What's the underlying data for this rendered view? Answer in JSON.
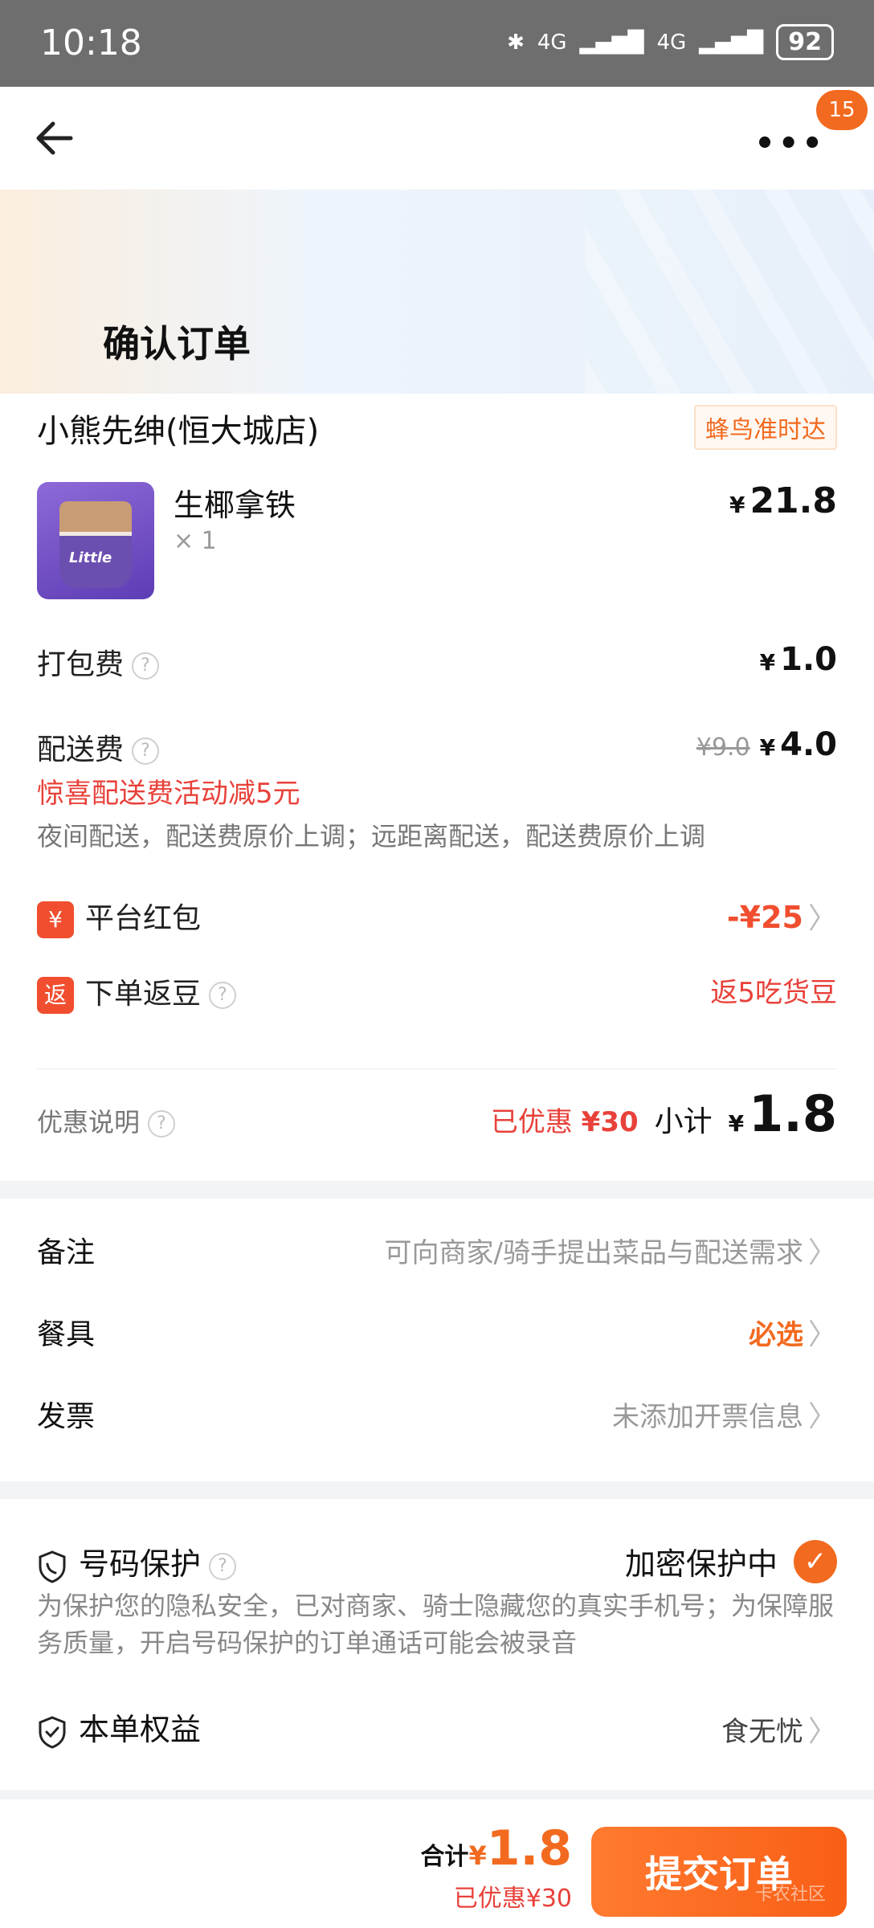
{
  "status_bar": {
    "time": "10:18",
    "battery": "92",
    "signal_labels": [
      "4G",
      "4G"
    ]
  },
  "nav": {
    "more_label": "•••",
    "badge": "15"
  },
  "page_title": "确认订单",
  "shop": {
    "name": "小熊先绅(恒大城店)",
    "delivery_tag": "蜂鸟准时达"
  },
  "item": {
    "name": "生椰拿铁",
    "qty": "× 1",
    "price": "21.8",
    "currency": "¥",
    "image_text": "Little"
  },
  "fees": {
    "packing_label": "打包费",
    "packing_price": "1.0",
    "delivery_label": "配送费",
    "delivery_original": "¥9.0",
    "delivery_price": "4.0",
    "delivery_promo": "惊喜配送费活动减5元",
    "delivery_note": "夜间配送，配送费原价上调；远距离配送，配送费原价上调"
  },
  "benefits": {
    "red_packet_icon": "¥",
    "red_packet_label": "平台红包",
    "red_packet_value": "-¥25",
    "beans_icon": "返",
    "beans_label": "下单返豆",
    "beans_value": "返5吃货豆"
  },
  "summary": {
    "discount_label": "优惠说明",
    "saved_label": "已优惠",
    "saved_value": "¥30",
    "subtotal_label": "小计",
    "subtotal_value": "1.8"
  },
  "options": [
    {
      "label": "备注",
      "value": "可向商家/骑手提出菜品与配送需求"
    },
    {
      "label": "餐具",
      "value": "必选"
    },
    {
      "label": "发票",
      "value": "未添加开票信息"
    }
  ],
  "privacy": {
    "title": "号码保护",
    "status": "加密保护中",
    "desc": "为保护您的隐私安全，已对商家、骑士隐藏您的真实手机号；为保障服务质量，开启号码保护的订单通话可能会被录音",
    "rights_label": "本单权益",
    "rights_value": "食无忧"
  },
  "bottom": {
    "total_label": "合计",
    "total_value": "1.8",
    "saved": "已优惠¥30",
    "submit_label": "提交订单",
    "watermark": "卡农社区"
  },
  "colors": {
    "accent": "#f26a1f",
    "promo_red": "#e8413a"
  }
}
